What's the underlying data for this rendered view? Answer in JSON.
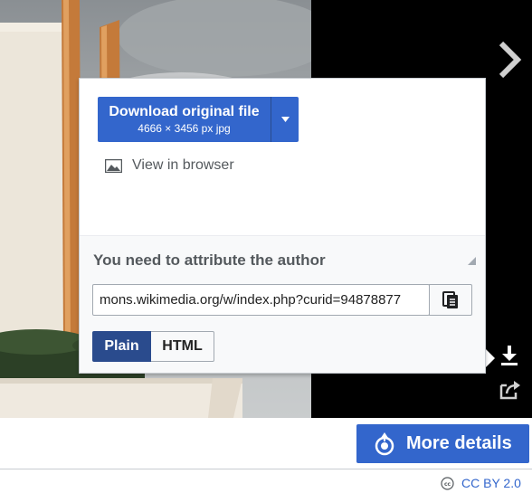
{
  "lightbox": {
    "next_icon": "chevron-right-icon",
    "download_icon": "download-icon",
    "share_icon": "share-icon"
  },
  "download_popup": {
    "download_button": {
      "label": "Download original file",
      "details": "4666 × 3456 px jpg",
      "dropdown_icon": "caret-down-icon"
    },
    "view_in_browser": {
      "label": "View in browser",
      "icon": "image-icon"
    },
    "attribution": {
      "title": "You need to attribute the author",
      "collapse_icon": "triangle-collapse-icon",
      "value": "mons.wikimedia.org/w/index.php?curid=94878877",
      "copy_icon": "clipboard-copy-icon",
      "formats": [
        "Plain",
        "HTML"
      ],
      "selected_format": "Plain"
    }
  },
  "footer": {
    "more_details_label": "More details",
    "more_details_icon": "commons-logo-icon",
    "license_label": "CC BY 2.0",
    "license_icon": "cc-icon"
  },
  "colors": {
    "accent": "#3366cc",
    "accent_dark": "#2a4b8d",
    "panel_bg": "#f8f9fa",
    "text_muted": "#54595d"
  }
}
